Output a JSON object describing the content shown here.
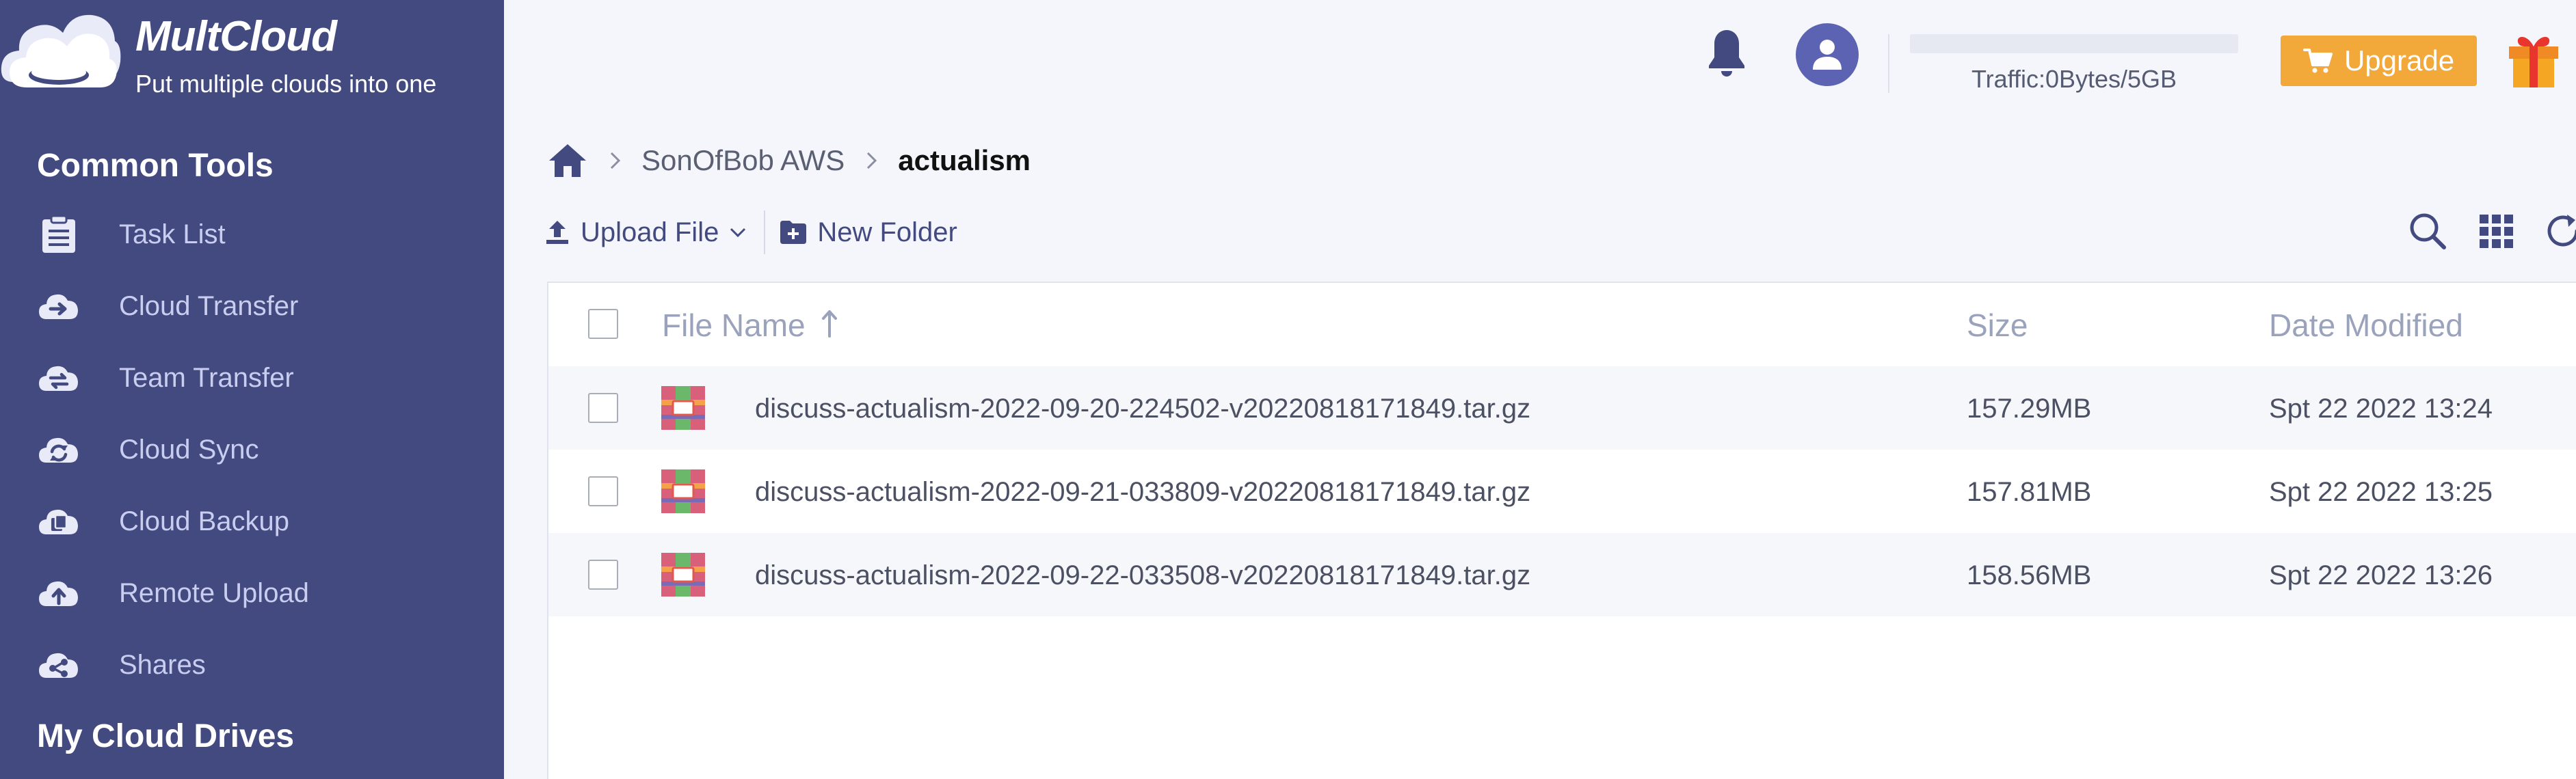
{
  "app": {
    "name": "MultCloud",
    "tagline": "Put multiple clouds into one"
  },
  "sidebar": {
    "section_common": "Common Tools",
    "items": [
      {
        "label": "Task List",
        "icon": "task-list-icon"
      },
      {
        "label": "Cloud Transfer",
        "icon": "cloud-transfer-icon"
      },
      {
        "label": "Team Transfer",
        "icon": "team-transfer-icon"
      },
      {
        "label": "Cloud Sync",
        "icon": "cloud-sync-icon"
      },
      {
        "label": "Cloud Backup",
        "icon": "cloud-backup-icon"
      },
      {
        "label": "Remote Upload",
        "icon": "remote-upload-icon"
      },
      {
        "label": "Shares",
        "icon": "share-icon"
      }
    ],
    "section_drives": "My Cloud Drives"
  },
  "header": {
    "traffic_text": "Traffic:0Bytes/5GB",
    "traffic_used_fraction": 0,
    "upgrade_label": "Upgrade"
  },
  "breadcrumb": {
    "items": [
      "SonOfBob AWS"
    ],
    "current": "actualism"
  },
  "toolbar": {
    "upload_label": "Upload File",
    "new_folder_label": "New Folder"
  },
  "table": {
    "columns": {
      "name": "File Name",
      "size": "Size",
      "date": "Date Modified"
    },
    "rows": [
      {
        "name": "discuss-actualism-2022-09-20-224502-v20220818171849.tar.gz",
        "size": "157.29MB",
        "date": "Spt 22 2022 13:24"
      },
      {
        "name": "discuss-actualism-2022-09-21-033809-v20220818171849.tar.gz",
        "size": "157.81MB",
        "date": "Spt 22 2022 13:25"
      },
      {
        "name": "discuss-actualism-2022-09-22-033508-v20220818171849.tar.gz",
        "size": "158.56MB",
        "date": "Spt 22 2022 13:26"
      }
    ]
  },
  "colors": {
    "sidebar_bg": "#434a80",
    "accent": "#5d63b3",
    "upgrade": "#f3a83a"
  }
}
